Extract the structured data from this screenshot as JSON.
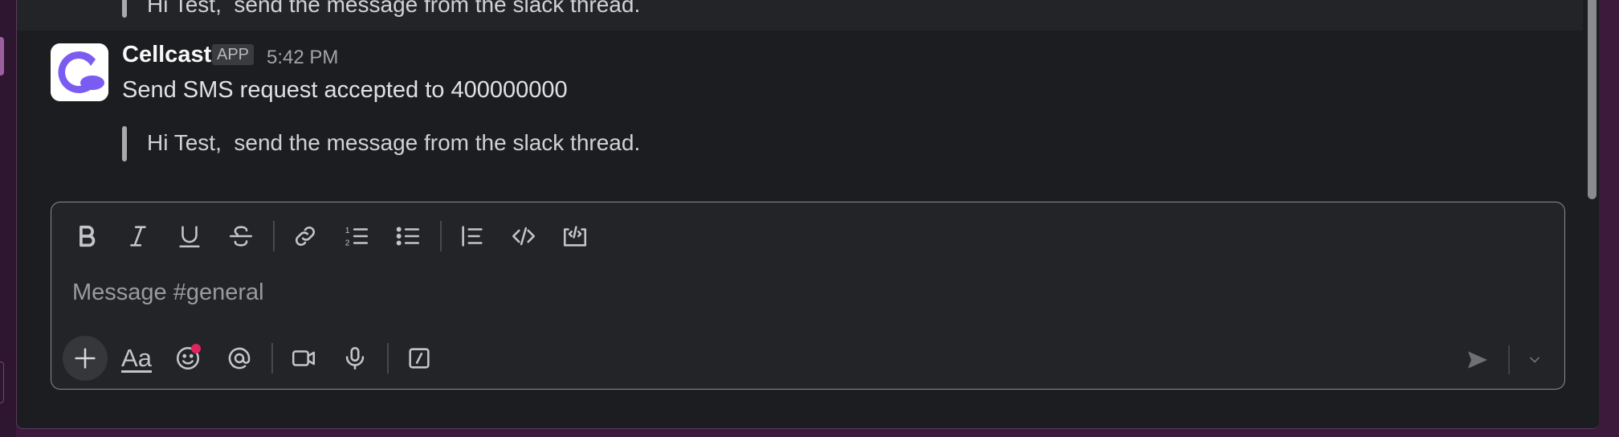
{
  "previous_message": {
    "quote_text": "Hi Test,  send the message from the slack thread."
  },
  "message": {
    "author": "Cellcast",
    "badge": "APP",
    "time": "5:42 PM",
    "text": "Send SMS request accepted to 400000000",
    "quote_text": "Hi Test,  send the message from the slack thread.",
    "avatar_color": "#7b5cf0"
  },
  "composer": {
    "placeholder": "Message #general",
    "format_toolbar": [
      "bold-icon",
      "italic-icon",
      "underline-icon",
      "strikethrough-icon",
      "link-icon",
      "ordered-list-icon",
      "bulleted-list-icon",
      "blockquote-icon",
      "code-icon",
      "code-block-icon"
    ],
    "bottom_toolbar": {
      "text_format_label": "Aa",
      "icons": [
        "plus-icon",
        "emoji-icon",
        "mention-icon",
        "video-icon",
        "microphone-icon",
        "slash-command-icon",
        "send-icon",
        "chevron-down-icon"
      ]
    }
  },
  "colors": {
    "background": "#1c1d21",
    "composer_border": "#8a8b8f",
    "sidebar": "#3b1a3c",
    "notification_dot": "#e0245e"
  }
}
